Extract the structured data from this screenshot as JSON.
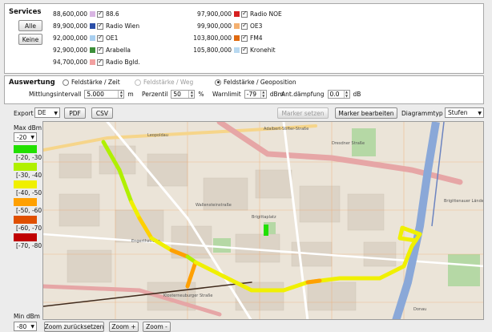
{
  "services": {
    "title": "Services",
    "all_label": "Alle",
    "none_label": "Keine",
    "left_col": [
      {
        "freq": "88,600,000",
        "name": "88.6",
        "color": "#d8b4e2"
      },
      {
        "freq": "89,900,000",
        "name": "Radio Wien",
        "color": "#2b4fa8"
      },
      {
        "freq": "92,000,000",
        "name": "OE1",
        "color": "#a8cff0"
      },
      {
        "freq": "92,900,000",
        "name": "Arabella",
        "color": "#3d8f3a"
      },
      {
        "freq": "94,700,000",
        "name": "Radio Bgld.",
        "color": "#f2a0a0"
      }
    ],
    "right_col": [
      {
        "freq": "97,900,000",
        "name": "Radio NOE",
        "color": "#d62020"
      },
      {
        "freq": "99,900,000",
        "name": "OE3",
        "color": "#f4b070"
      },
      {
        "freq": "103,800,000",
        "name": "FM4",
        "color": "#e06a10"
      },
      {
        "freq": "105,800,000",
        "name": "Kronehit",
        "color": "#b8d8f0"
      }
    ]
  },
  "analysis": {
    "title": "Auswertung",
    "radio_time": "Feldstärke / Zeit",
    "radio_path": "Feldstärke / Weg",
    "radio_geo": "Feldstärke / Geoposition",
    "avg_interval_label": "Mittlungsintervall",
    "avg_interval_value": "5.000",
    "avg_unit": "m",
    "percentile_label": "Perzentil",
    "percentile_value": "50",
    "percentile_unit": "%",
    "warn_label": "Warnlimit",
    "warn_value": "-79",
    "warn_unit": "dBm",
    "atten_label": "Ant.dämpfung",
    "atten_value": "0.0",
    "atten_unit": "dB"
  },
  "toolbar": {
    "export_label": "Export",
    "export_value": "DE",
    "pdf_label": "PDF",
    "csv_label": "CSV",
    "set_marker_label": "Marker setzen",
    "edit_marker_label": "Marker bearbeiten",
    "diagram_type_label": "Diagrammtyp",
    "diagram_type_value": "Stufen"
  },
  "legend": {
    "max_label": "Max dBm",
    "max_value": "-20",
    "min_label": "Min dBm",
    "min_value": "-80",
    "levels": [
      {
        "label": "[-20, -30]",
        "color": "#22e000"
      },
      {
        "label": "[-30, -40]",
        "color": "#b0f000"
      },
      {
        "label": "[-40, -50]",
        "color": "#f0f000"
      },
      {
        "label": "[-50, -60]",
        "color": "#ffa000"
      },
      {
        "label": "[-60, -70]",
        "color": "#e05000"
      },
      {
        "label": "[-70, -80]",
        "color": "#c00000"
      }
    ]
  },
  "zoom": {
    "reset_label": "Zoom zurücksetzen",
    "in_label": "Zoom +",
    "out_label": "Zoom -"
  },
  "map": {
    "streets": [
      "Adalbert-Stifter-Straße",
      "Leopoldau",
      "Dresdner Straße",
      "Brigittenauer Lände",
      "Wallensteinstraße",
      "Engerthstraße",
      "Brigittaplatz",
      "Klosterneuburger Straße",
      "Donau"
    ]
  }
}
